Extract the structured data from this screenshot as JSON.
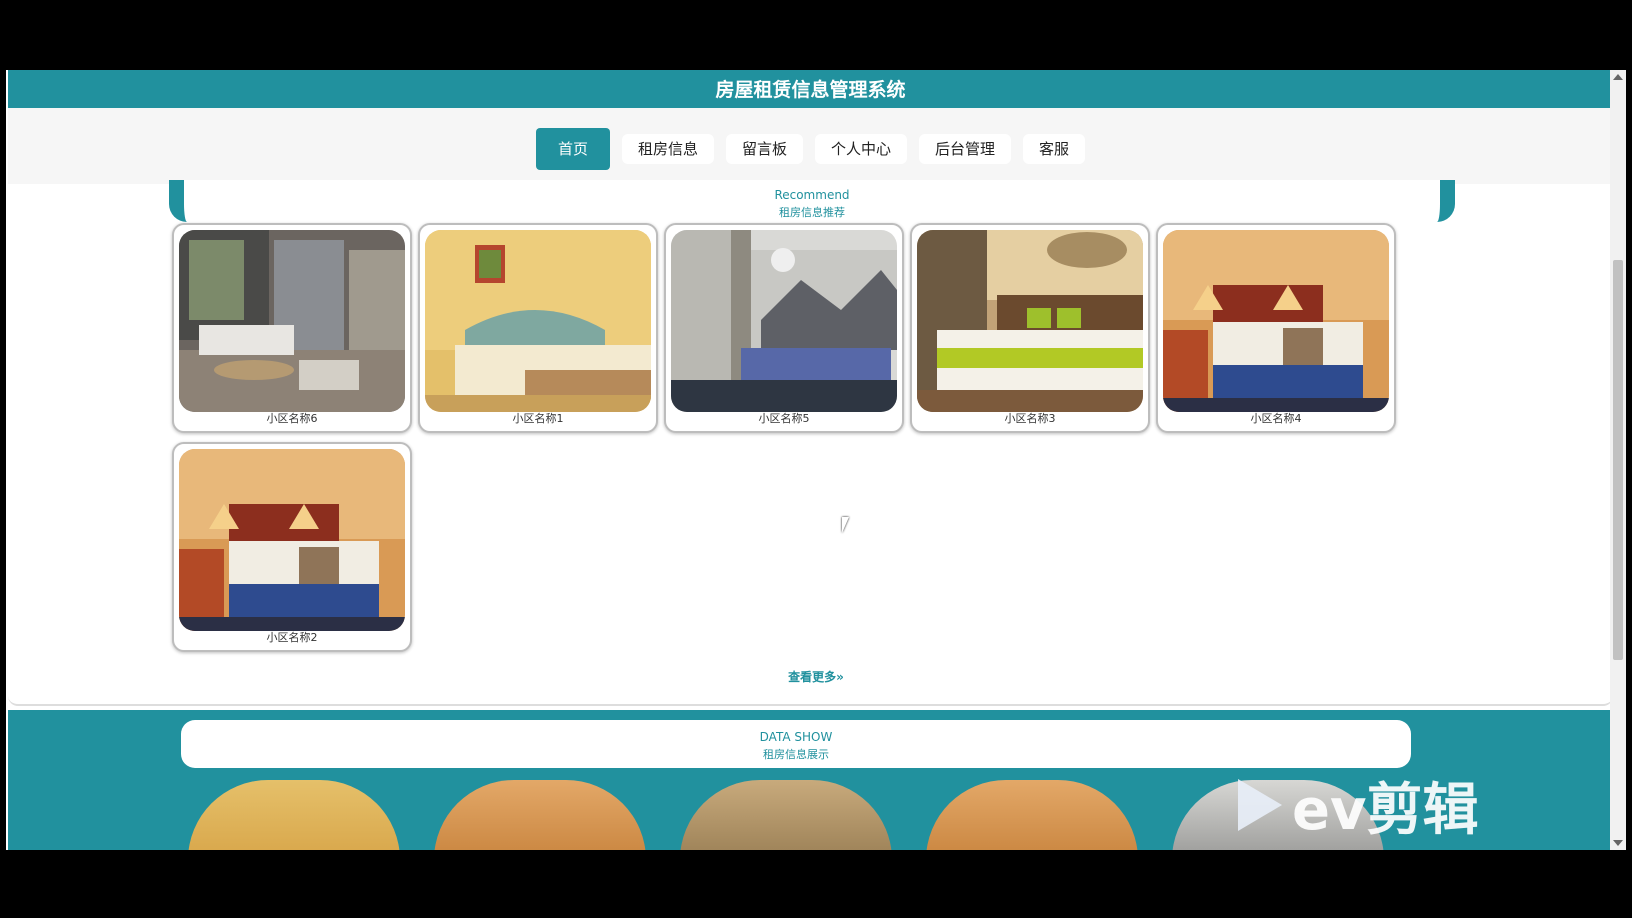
{
  "app": {
    "title": "房屋租赁信息管理系统"
  },
  "nav": {
    "items": [
      {
        "label": "首页",
        "active": true
      },
      {
        "label": "租房信息",
        "active": false
      },
      {
        "label": "留言板",
        "active": false
      },
      {
        "label": "个人中心",
        "active": false
      },
      {
        "label": "后台管理",
        "active": false
      },
      {
        "label": "客服",
        "active": false
      }
    ]
  },
  "recommend": {
    "title_en": "Recommend",
    "title_cn": "租房信息推荐",
    "listings": [
      {
        "name": "小区名称6"
      },
      {
        "name": "小区名称1"
      },
      {
        "name": "小区名称5"
      },
      {
        "name": "小区名称3"
      },
      {
        "name": "小区名称4"
      },
      {
        "name": "小区名称2"
      }
    ],
    "more_label": "查看更多»"
  },
  "data_show": {
    "title_en": "DATA SHOW",
    "title_cn": "租房信息展示"
  },
  "watermark": {
    "text": "ev剪辑"
  },
  "colors": {
    "accent": "#21919e",
    "nav_bg": "#f6f6f6"
  }
}
